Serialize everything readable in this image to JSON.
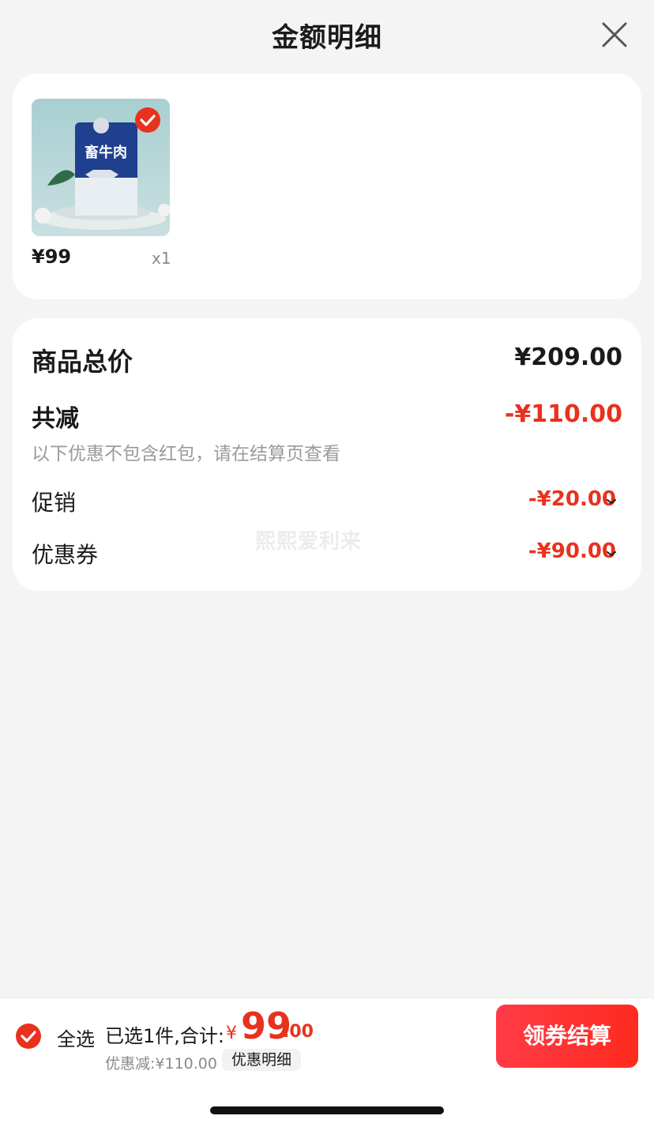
{
  "header": {
    "title": "金额明细",
    "close_icon": "close-icon"
  },
  "product": {
    "price": "¥99",
    "quantity": "x1",
    "image_text": "畜牛肉",
    "selected": true
  },
  "summary": {
    "total_label": "商品总价",
    "total_value": "¥209.00",
    "reduce_label": "共减",
    "reduce_value": "-¥110.00",
    "note": "以下优惠不包含红包，请在结算页查看",
    "promo_label": "促销",
    "promo_value": "-¥20.00",
    "coupon_label": "优惠券",
    "coupon_value": "-¥90.00"
  },
  "watermark": "熙熙爱利来",
  "bottom_bar": {
    "select_all_label": "全选",
    "selected_text": "已选1件,合计:",
    "currency": "¥",
    "sum_integer": "99",
    "sum_decimal": ".00",
    "discount_text": "优惠减:¥110.00",
    "detail_label": "优惠明细",
    "checkout_label": "领券结算"
  },
  "colors": {
    "accent_red": "#e8321e",
    "background": "#f4f4f4"
  }
}
